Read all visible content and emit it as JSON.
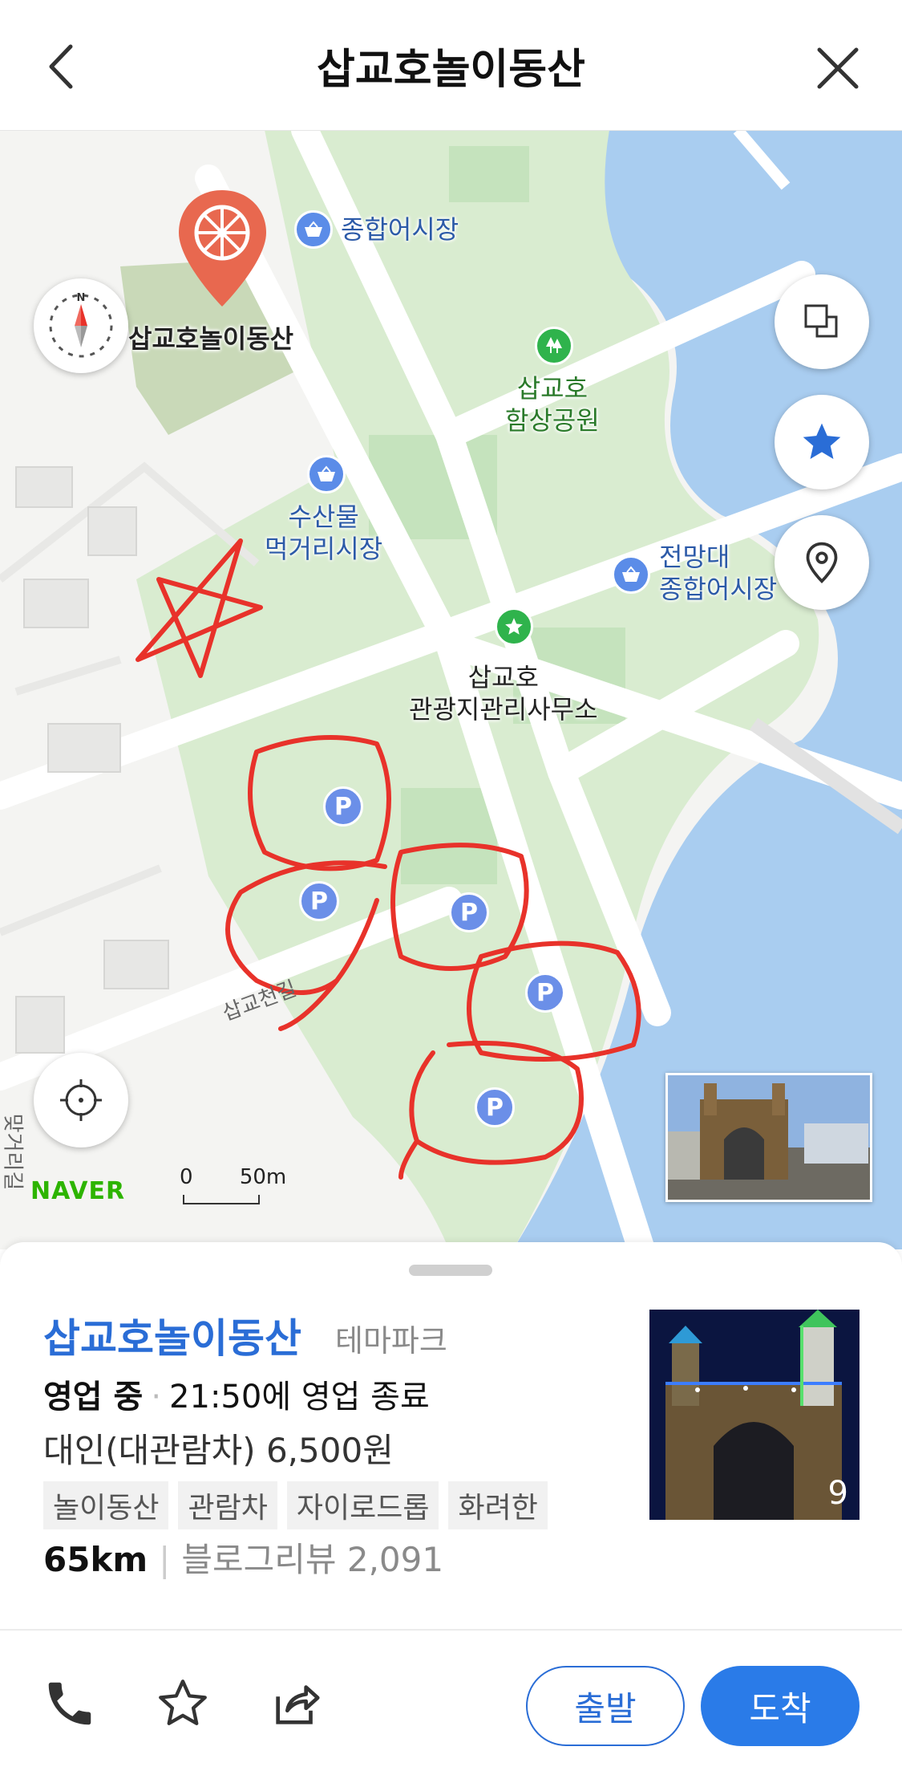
{
  "header": {
    "title": "삽교호놀이동산",
    "back_icon": "chevron-left-icon",
    "close_icon": "close-icon"
  },
  "map": {
    "labels": {
      "place_pin": "삽교호놀이동산",
      "fish_market": "종합어시장",
      "park_line1": "삽교호",
      "park_line2": "함상공원",
      "seafood_line1": "수산물",
      "seafood_line2": "먹거리시장",
      "observatory_line1": "전망대",
      "observatory_line2": "종합어시장",
      "office_line1": "삽교호",
      "office_line2": "관광지관리사무소",
      "road1": "삽교천길",
      "road2": "맞거리길",
      "parking": "P"
    },
    "brand": "NAVER",
    "scale_zero": "0",
    "scale_value": "50m",
    "colors": {
      "water": "#a9cdf0",
      "park": "#d9ecd0",
      "road": "#ffffff",
      "annotation": "#e8322a"
    }
  },
  "place": {
    "name": "삽교호놀이동산",
    "category": "테마파크",
    "status_bold": "영업 중",
    "status_rest": "21:50에 영업 종료",
    "price": "대인(대관람차) 6,500원",
    "tags": [
      "놀이동산",
      "관람차",
      "자이로드롭",
      "화려한"
    ],
    "distance": "65km",
    "reviews": "블로그리뷰 2,091",
    "photo_count": "9"
  },
  "actions": {
    "depart": "출발",
    "arrive": "도착"
  }
}
